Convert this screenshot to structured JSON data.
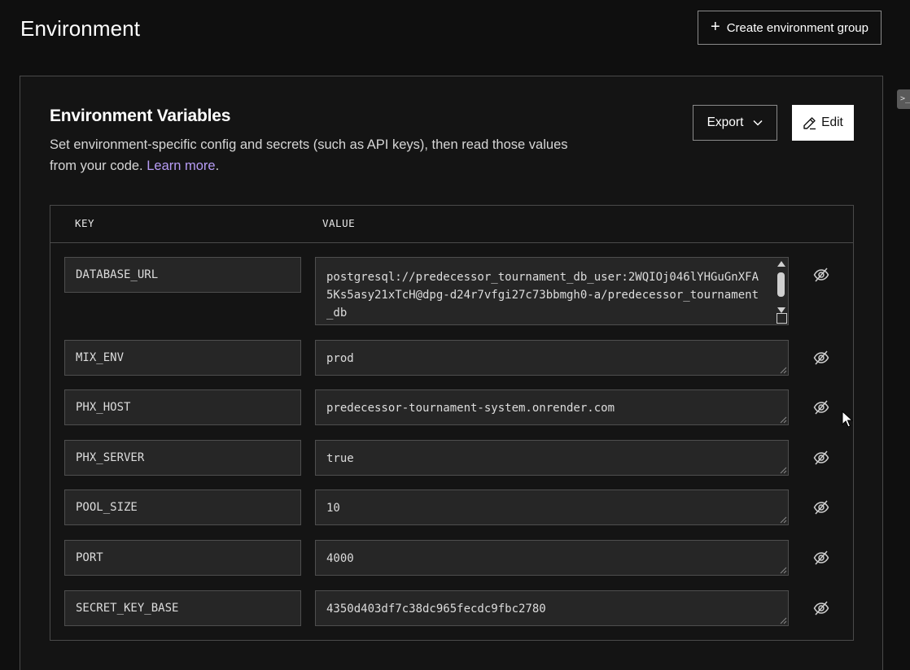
{
  "page": {
    "title": "Environment",
    "create_group_label": "Create environment group"
  },
  "env_section": {
    "title": "Environment Variables",
    "description": "Set environment-specific config and secrets (such as API keys), then read those values from your code. ",
    "learn_more": "Learn more",
    "description_end": ".",
    "export_label": "Export",
    "edit_label": "Edit"
  },
  "table": {
    "key_header": "KEY",
    "value_header": "VALUE",
    "rows": [
      {
        "key": "DATABASE_URL",
        "value": "postgresql://predecessor_tournament_db_user:2WQIOj046lYHGuGnXFA5Ks5asy21xTcH@dpg-d24r7vfgi27c73bbmgh0-a/predecessor_tournament_db"
      },
      {
        "key": "MIX_ENV",
        "value": "prod"
      },
      {
        "key": "PHX_HOST",
        "value": "predecessor-tournament-system.onrender.com"
      },
      {
        "key": "PHX_SERVER",
        "value": "true"
      },
      {
        "key": "POOL_SIZE",
        "value": "10"
      },
      {
        "key": "PORT",
        "value": "4000"
      },
      {
        "key": "SECRET_KEY_BASE",
        "value": "4350d403df7c38dc965fecdc9fbc2780"
      }
    ]
  },
  "icons": {
    "plus": "plus-icon",
    "chevron": "chevron-down-icon",
    "pencil": "pencil-icon",
    "eye_hidden": "eye-off-icon"
  },
  "colors": {
    "background": "#0f0f0f",
    "link": "#b79cf5",
    "field_bg": "#262626"
  }
}
